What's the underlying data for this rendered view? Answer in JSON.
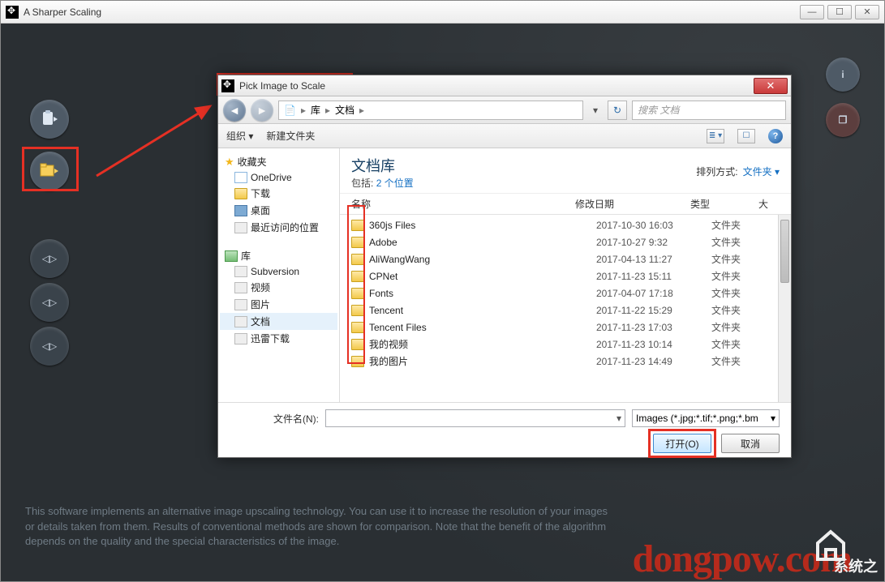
{
  "main_window": {
    "title": "A Sharper Scaling",
    "footer": "This software implements an alternative image upscaling technology. You can use it to increase the resolution of your images or details taken from them. Results of conventional methods are shown for comparison. Note that the benefit of the algorithm depends on the quality and the special characteristics of the image."
  },
  "dialog": {
    "title": "Pick Image to Scale",
    "breadcrumb": {
      "root": "库",
      "folder": "文档",
      "sep": "▸"
    },
    "search_placeholder": "搜索 文档",
    "toolbar": {
      "organize": "组织 ▾",
      "new_folder": "新建文件夹"
    },
    "tree": {
      "favorites": "收藏夹",
      "onedrive": "OneDrive",
      "downloads": "下载",
      "desktop": "桌面",
      "recent": "最近访问的位置",
      "library": "库",
      "subversion": "Subversion",
      "video": "视频",
      "pictures": "图片",
      "documents": "文档",
      "thunder": "迅雷下载"
    },
    "lib_header": {
      "title": "文档库",
      "includes_label": "包括:",
      "includes_count": "2 个位置",
      "sort_label": "排列方式:",
      "sort_value": "文件夹 ▾"
    },
    "columns": {
      "name": "名称",
      "date": "修改日期",
      "type": "类型",
      "size": "大"
    },
    "files": [
      {
        "name": "360js Files",
        "date": "2017-10-30 16:03",
        "type": "文件夹"
      },
      {
        "name": "Adobe",
        "date": "2017-10-27 9:32",
        "type": "文件夹"
      },
      {
        "name": "AliWangWang",
        "date": "2017-04-13 11:27",
        "type": "文件夹"
      },
      {
        "name": "CPNet",
        "date": "2017-11-23 15:11",
        "type": "文件夹"
      },
      {
        "name": "Fonts",
        "date": "2017-04-07 17:18",
        "type": "文件夹"
      },
      {
        "name": "Tencent",
        "date": "2017-11-22 15:29",
        "type": "文件夹"
      },
      {
        "name": "Tencent Files",
        "date": "2017-11-23 17:03",
        "type": "文件夹"
      },
      {
        "name": "我的视频",
        "date": "2017-11-23 10:14",
        "type": "文件夹"
      },
      {
        "name": "我的图片",
        "date": "2017-11-23 14:49",
        "type": "文件夹"
      }
    ],
    "filename_label": "文件名(N):",
    "filter": "Images (*.jpg;*.tif;*.png;*.bm",
    "open_btn": "打开(O)",
    "cancel_btn": "取消"
  },
  "watermark": "dongpow.com",
  "logo_text": "系统之"
}
